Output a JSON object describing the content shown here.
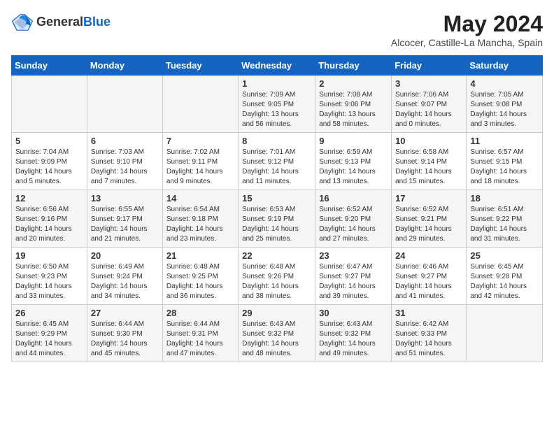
{
  "header": {
    "logo_line1": "General",
    "logo_line2": "Blue",
    "month_year": "May 2024",
    "location": "Alcocer, Castille-La Mancha, Spain"
  },
  "days_of_week": [
    "Sunday",
    "Monday",
    "Tuesday",
    "Wednesday",
    "Thursday",
    "Friday",
    "Saturday"
  ],
  "weeks": [
    [
      {
        "day": "",
        "info": ""
      },
      {
        "day": "",
        "info": ""
      },
      {
        "day": "",
        "info": ""
      },
      {
        "day": "1",
        "info": "Sunrise: 7:09 AM\nSunset: 9:05 PM\nDaylight: 13 hours and 56 minutes."
      },
      {
        "day": "2",
        "info": "Sunrise: 7:08 AM\nSunset: 9:06 PM\nDaylight: 13 hours and 58 minutes."
      },
      {
        "day": "3",
        "info": "Sunrise: 7:06 AM\nSunset: 9:07 PM\nDaylight: 14 hours and 0 minutes."
      },
      {
        "day": "4",
        "info": "Sunrise: 7:05 AM\nSunset: 9:08 PM\nDaylight: 14 hours and 3 minutes."
      }
    ],
    [
      {
        "day": "5",
        "info": "Sunrise: 7:04 AM\nSunset: 9:09 PM\nDaylight: 14 hours and 5 minutes."
      },
      {
        "day": "6",
        "info": "Sunrise: 7:03 AM\nSunset: 9:10 PM\nDaylight: 14 hours and 7 minutes."
      },
      {
        "day": "7",
        "info": "Sunrise: 7:02 AM\nSunset: 9:11 PM\nDaylight: 14 hours and 9 minutes."
      },
      {
        "day": "8",
        "info": "Sunrise: 7:01 AM\nSunset: 9:12 PM\nDaylight: 14 hours and 11 minutes."
      },
      {
        "day": "9",
        "info": "Sunrise: 6:59 AM\nSunset: 9:13 PM\nDaylight: 14 hours and 13 minutes."
      },
      {
        "day": "10",
        "info": "Sunrise: 6:58 AM\nSunset: 9:14 PM\nDaylight: 14 hours and 15 minutes."
      },
      {
        "day": "11",
        "info": "Sunrise: 6:57 AM\nSunset: 9:15 PM\nDaylight: 14 hours and 18 minutes."
      }
    ],
    [
      {
        "day": "12",
        "info": "Sunrise: 6:56 AM\nSunset: 9:16 PM\nDaylight: 14 hours and 20 minutes."
      },
      {
        "day": "13",
        "info": "Sunrise: 6:55 AM\nSunset: 9:17 PM\nDaylight: 14 hours and 21 minutes."
      },
      {
        "day": "14",
        "info": "Sunrise: 6:54 AM\nSunset: 9:18 PM\nDaylight: 14 hours and 23 minutes."
      },
      {
        "day": "15",
        "info": "Sunrise: 6:53 AM\nSunset: 9:19 PM\nDaylight: 14 hours and 25 minutes."
      },
      {
        "day": "16",
        "info": "Sunrise: 6:52 AM\nSunset: 9:20 PM\nDaylight: 14 hours and 27 minutes."
      },
      {
        "day": "17",
        "info": "Sunrise: 6:52 AM\nSunset: 9:21 PM\nDaylight: 14 hours and 29 minutes."
      },
      {
        "day": "18",
        "info": "Sunrise: 6:51 AM\nSunset: 9:22 PM\nDaylight: 14 hours and 31 minutes."
      }
    ],
    [
      {
        "day": "19",
        "info": "Sunrise: 6:50 AM\nSunset: 9:23 PM\nDaylight: 14 hours and 33 minutes."
      },
      {
        "day": "20",
        "info": "Sunrise: 6:49 AM\nSunset: 9:24 PM\nDaylight: 14 hours and 34 minutes."
      },
      {
        "day": "21",
        "info": "Sunrise: 6:48 AM\nSunset: 9:25 PM\nDaylight: 14 hours and 36 minutes."
      },
      {
        "day": "22",
        "info": "Sunrise: 6:48 AM\nSunset: 9:26 PM\nDaylight: 14 hours and 38 minutes."
      },
      {
        "day": "23",
        "info": "Sunrise: 6:47 AM\nSunset: 9:27 PM\nDaylight: 14 hours and 39 minutes."
      },
      {
        "day": "24",
        "info": "Sunrise: 6:46 AM\nSunset: 9:27 PM\nDaylight: 14 hours and 41 minutes."
      },
      {
        "day": "25",
        "info": "Sunrise: 6:45 AM\nSunset: 9:28 PM\nDaylight: 14 hours and 42 minutes."
      }
    ],
    [
      {
        "day": "26",
        "info": "Sunrise: 6:45 AM\nSunset: 9:29 PM\nDaylight: 14 hours and 44 minutes."
      },
      {
        "day": "27",
        "info": "Sunrise: 6:44 AM\nSunset: 9:30 PM\nDaylight: 14 hours and 45 minutes."
      },
      {
        "day": "28",
        "info": "Sunrise: 6:44 AM\nSunset: 9:31 PM\nDaylight: 14 hours and 47 minutes."
      },
      {
        "day": "29",
        "info": "Sunrise: 6:43 AM\nSunset: 9:32 PM\nDaylight: 14 hours and 48 minutes."
      },
      {
        "day": "30",
        "info": "Sunrise: 6:43 AM\nSunset: 9:32 PM\nDaylight: 14 hours and 49 minutes."
      },
      {
        "day": "31",
        "info": "Sunrise: 6:42 AM\nSunset: 9:33 PM\nDaylight: 14 hours and 51 minutes."
      },
      {
        "day": "",
        "info": ""
      }
    ]
  ]
}
